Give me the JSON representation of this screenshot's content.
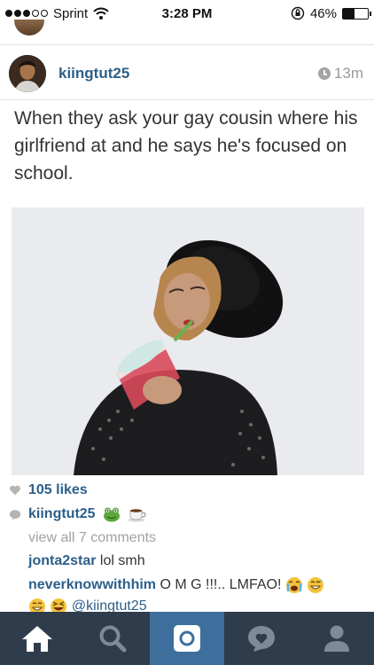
{
  "status_bar": {
    "carrier": "Sprint",
    "time": "3:28 PM",
    "battery": "46%",
    "battery_level": 0.46,
    "signal_bars_filled": 3,
    "signal_bars_total": 5
  },
  "post": {
    "username": "kiingtut25",
    "time_ago": "13m",
    "meme_text": "When they ask your gay cousin where his girlfriend at and he says he's focused on school.",
    "likes": "105 likes",
    "caption": {
      "user": "kiingtut25",
      "emojis": [
        "frog-face-icon",
        "coffee-cup-icon"
      ]
    },
    "view_all": "view all 7 comments",
    "comments": [
      {
        "user": "jonta2star",
        "text": "lol smh"
      },
      {
        "user": "neverknowwithhim",
        "text": "O M G !!!.. LMFAO!",
        "emojis_after": [
          "crying-face-icon",
          "grinning-sweat-icon"
        ]
      },
      {
        "user": "",
        "emojis_before": [
          "grinning-face-icon",
          "squinting-laugh-icon"
        ],
        "mention": "@kiingtut25"
      }
    ]
  },
  "tabs": [
    {
      "name": "home",
      "icon": "home-icon",
      "active": false
    },
    {
      "name": "explore",
      "icon": "search-icon",
      "active": false
    },
    {
      "name": "camera",
      "icon": "camera-icon",
      "active": true
    },
    {
      "name": "activity",
      "icon": "heart-bubble-icon",
      "active": false
    },
    {
      "name": "profile",
      "icon": "person-icon",
      "active": false
    }
  ],
  "colors": {
    "link_blue": "#2c5f8a",
    "tab_bar": "#2f3c4b",
    "tab_active": "#3d6e9c",
    "muted_text": "#a2a2a2"
  }
}
